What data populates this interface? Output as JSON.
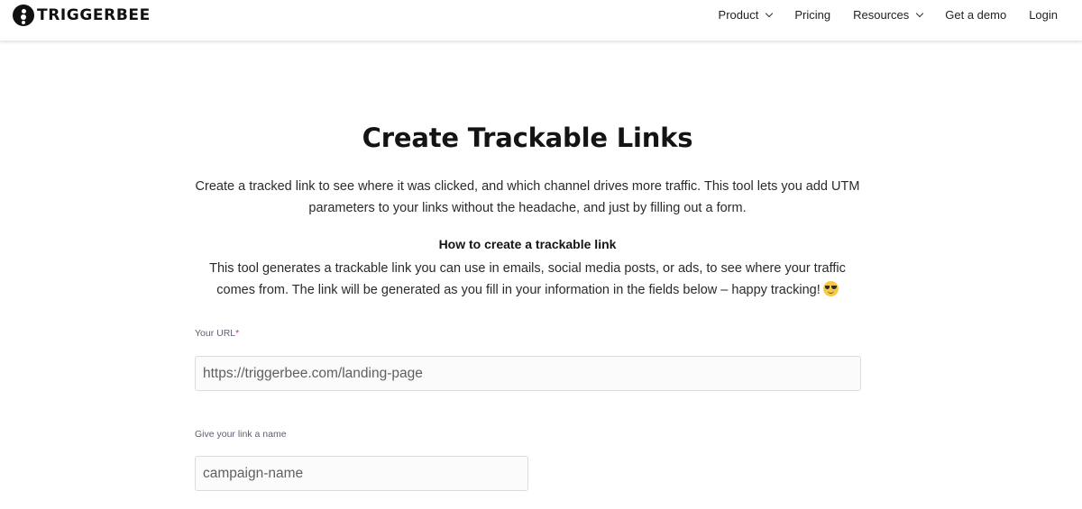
{
  "brand": {
    "name": "TRIGGERBEE",
    "logo_icon": "triggerbee-logo-icon"
  },
  "nav": {
    "product": "Product",
    "pricing": "Pricing",
    "resources": "Resources",
    "demo": "Get a demo",
    "login": "Login"
  },
  "page": {
    "title": "Create Trackable Links",
    "intro": "Create a tracked link to see where it was clicked, and which channel drives more traffic. This tool lets you add UTM parameters to your links without the headache, and just by filling out a form.",
    "howto_title": "How to create a trackable link",
    "howto_text": "This tool generates a trackable link you can use in emails, social media posts, or ads, to see where your traffic comes from. The link will be generated as you fill in your information in the fields below – happy tracking!",
    "howto_emoji": "smiling-face-with-sunglasses-icon"
  },
  "form": {
    "url_label": "Your URL",
    "url_required_mark": "*",
    "url_placeholder": "https://triggerbee.com/landing-page",
    "name_label": "Give your link a name",
    "name_placeholder": "campaign-name"
  },
  "colors": {
    "brand_dark": "#111111",
    "required_mark": "#e0245e",
    "label_text": "#5b5f73",
    "input_border": "#dcdcdc"
  }
}
